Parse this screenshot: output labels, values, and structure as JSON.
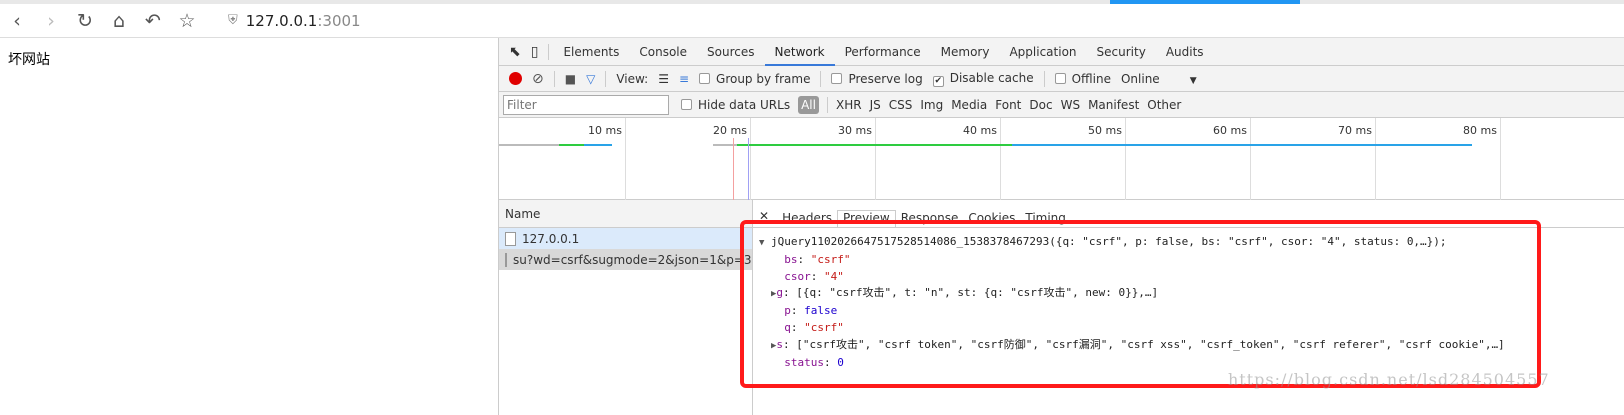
{
  "browser": {
    "url_host": "127.0.0.1",
    "url_port": ":3001",
    "icons": [
      "back-icon",
      "forward-icon",
      "reload-icon",
      "home-icon",
      "undo-icon",
      "star-icon",
      "shield-icon"
    ]
  },
  "page": {
    "text": "坏网站"
  },
  "devtools": {
    "tabs": [
      "Elements",
      "Console",
      "Sources",
      "Network",
      "Performance",
      "Memory",
      "Application",
      "Security",
      "Audits"
    ],
    "selected_tab": "Network",
    "toolbar": {
      "view_label": "View:",
      "group_by_frame": "Group by frame",
      "preserve_log": "Preserve log",
      "disable_cache": "Disable cache",
      "disable_cache_checked": true,
      "offline": "Offline",
      "throttle": "Online"
    },
    "filter": {
      "placeholder": "Filter",
      "hide_data_urls": "Hide data URLs",
      "types": [
        "All",
        "XHR",
        "JS",
        "CSS",
        "Img",
        "Media",
        "Font",
        "Doc",
        "WS",
        "Manifest",
        "Other"
      ]
    },
    "timeline": {
      "ticks": [
        "10 ms",
        "20 ms",
        "30 ms",
        "40 ms",
        "50 ms",
        "60 ms",
        "70 ms",
        "80 ms"
      ]
    },
    "name_header": "Name",
    "requests": [
      "127.0.0.1",
      "su?wd=csrf&sugmode=2&json=1&p=3..."
    ],
    "preview_tabs": [
      "Headers",
      "Preview",
      "Response",
      "Cookies",
      "Timing"
    ],
    "selected_preview_tab": "Preview",
    "json": {
      "root": "jQuery110202664751752851408​6_1538378467293({q: \"csrf\", p: false, bs: \"csrf\", csor: \"4\", status: 0,…});",
      "fields": [
        {
          "key": "bs",
          "value": "\"csrf\"",
          "type": "string",
          "expandable": false
        },
        {
          "key": "csor",
          "value": "\"4\"",
          "type": "string",
          "expandable": false
        },
        {
          "key": "g",
          "value": "[{q: \"csrf攻击\", t: \"n\", st: {q: \"csrf攻击\", new: 0}},…]",
          "type": "object",
          "expandable": true
        },
        {
          "key": "p",
          "value": "false",
          "type": "number",
          "expandable": false
        },
        {
          "key": "q",
          "value": "\"csrf\"",
          "type": "string",
          "expandable": false
        },
        {
          "key": "s",
          "value": "[\"csrf攻击\", \"csrf token\", \"csrf防御\", \"csrf漏洞\", \"csrf xss\", \"csrf_token\", \"csrf referer\", \"csrf cookie\",…]",
          "type": "object",
          "expandable": true
        },
        {
          "key": "status",
          "value": "0",
          "type": "number",
          "expandable": false
        }
      ]
    }
  },
  "watermark": "https://blog.csdn.net/lsd284504557",
  "colors": {
    "highlight_box": "#ff1a1a",
    "accent": "#3879d9",
    "record": "#e00000"
  }
}
